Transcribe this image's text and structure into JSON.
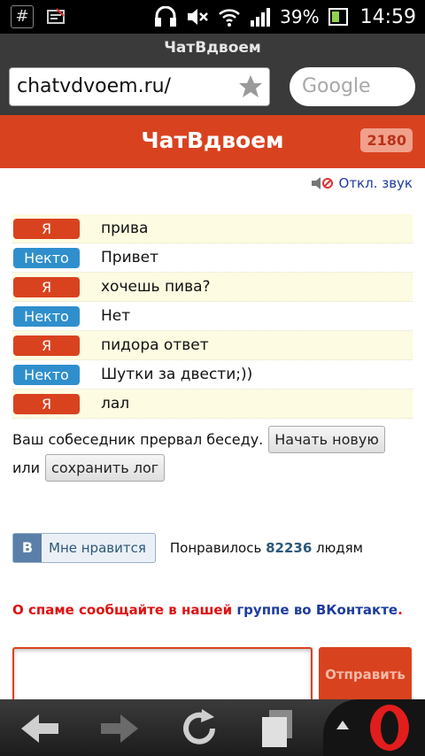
{
  "status": {
    "battery_pct": "39%",
    "time": "14:59",
    "hash": "#"
  },
  "browser": {
    "title": "ЧатВдвоем",
    "url": "chatvdvoem.ru/",
    "search_placeholder": "Google"
  },
  "site": {
    "title": "ЧатВдвоем",
    "online": "2180",
    "sound_toggle": "Откл. звук"
  },
  "chat": {
    "messages": [
      {
        "who": "Я",
        "text": "прива"
      },
      {
        "who": "Некто",
        "text": "Привет"
      },
      {
        "who": "Я",
        "text": "хочешь пива?"
      },
      {
        "who": "Некто",
        "text": "Нет"
      },
      {
        "who": "Я",
        "text": "пидора ответ"
      },
      {
        "who": "Некто",
        "text": "Шутки за двести;))"
      },
      {
        "who": "Я",
        "text": "лал"
      }
    ]
  },
  "ended": {
    "text": "Ваш собеседник прервал беседу.",
    "new_button": "Начать новую",
    "or": "или",
    "save_button": "сохранить лог"
  },
  "like": {
    "vk_logo": "В",
    "label": "Мне нравится",
    "prefix": "Понравилось",
    "count": "82236",
    "suffix": "людям"
  },
  "spam": {
    "text": "О спаме сообщайте в нашей",
    "link": "группе во ВКонтакте",
    "end": "."
  },
  "composer": {
    "send_label": "Отправить"
  },
  "colors": {
    "accent": "#d9421f",
    "me_badge": "#d9421f",
    "other_badge": "#2f8fcd",
    "link": "#1d3c9e"
  }
}
